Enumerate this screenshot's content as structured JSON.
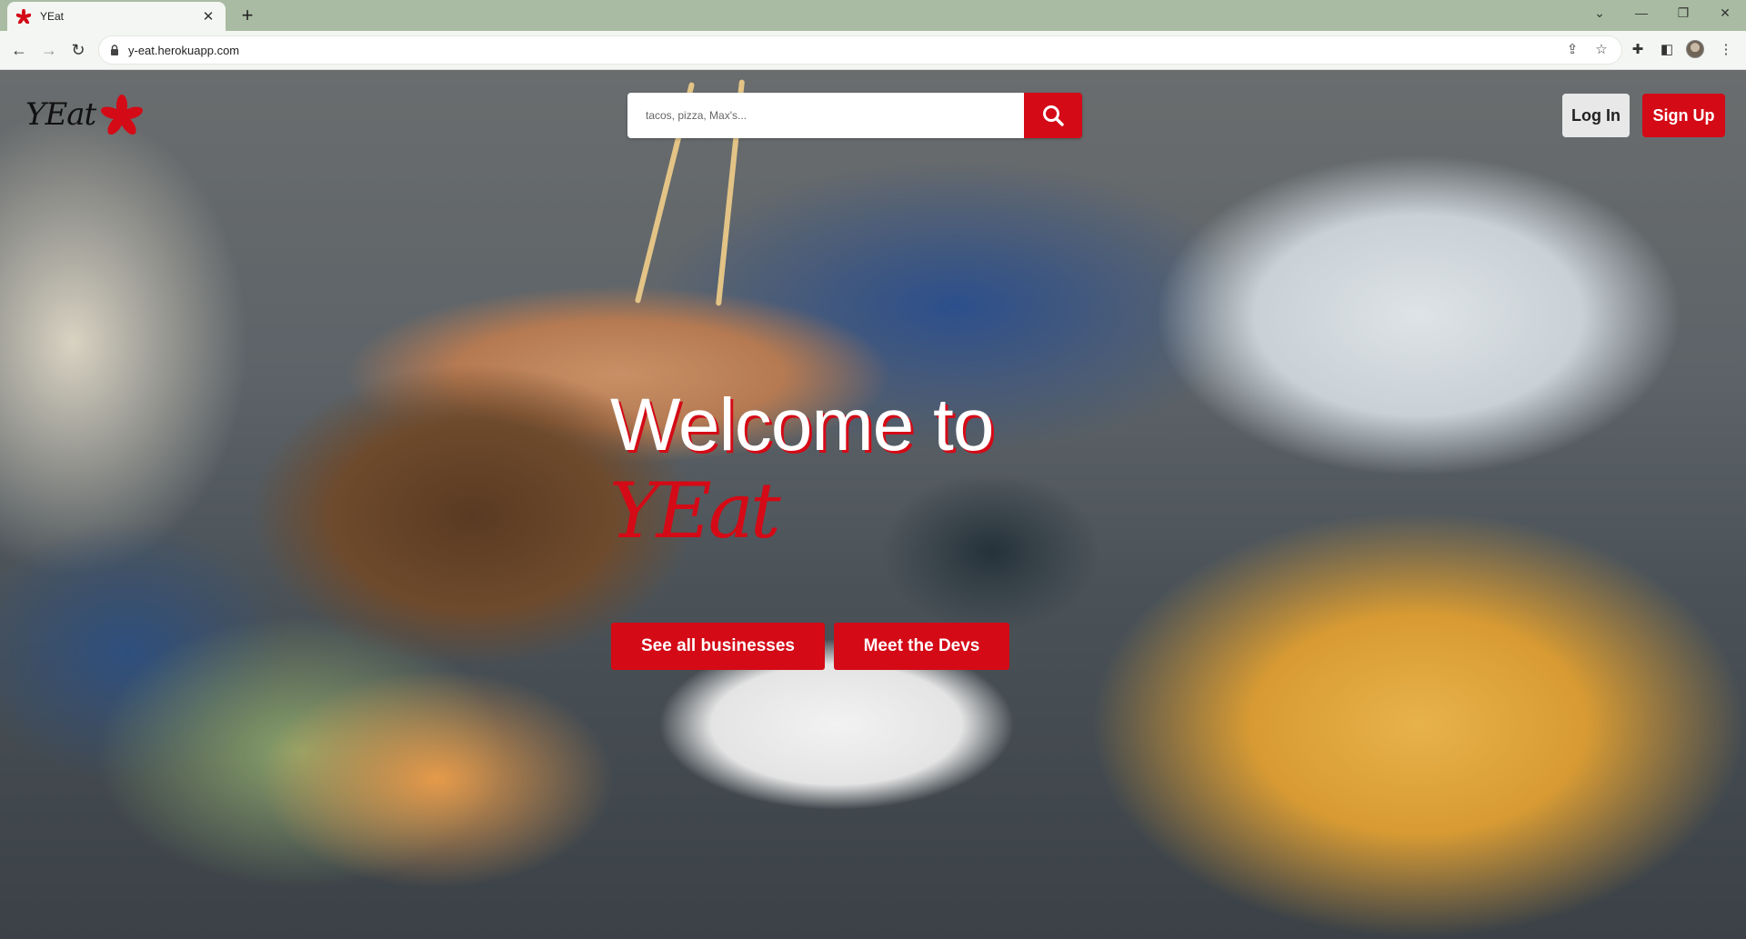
{
  "browser": {
    "tab_title": "YEat",
    "tab_close": "✕",
    "new_tab": "+",
    "url": "y-eat.herokuapp.com"
  },
  "header": {
    "logo_text": "YEat",
    "search_placeholder": "tacos, pizza, Max's...",
    "login_label": "Log In",
    "signup_label": "Sign Up"
  },
  "hero": {
    "welcome": "Welcome to",
    "brand": "YEat",
    "see_all_label": "See all businesses",
    "meet_devs_label": "Meet the Devs"
  },
  "colors": {
    "brand_red": "#d40a16"
  }
}
